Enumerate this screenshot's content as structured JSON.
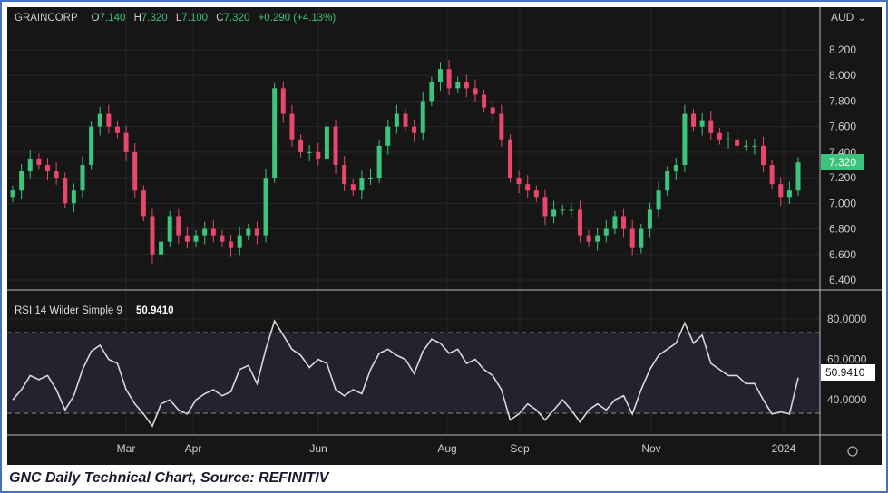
{
  "header": {
    "symbol": "GRAINCORP",
    "o_label": "O",
    "open": "7.140",
    "h_label": "H",
    "high": "7.320",
    "l_label": "L",
    "low": "7.100",
    "c_label": "C",
    "close": "7.320",
    "change": "+0.290 (+4.13%)",
    "currency": "AUD"
  },
  "rsi_header": {
    "label": "RSI 14 Wilder Simple 9",
    "value": "50.9410"
  },
  "caption": "GNC Daily Technical Chart, Source: REFINITIV",
  "colors": {
    "up": "#3cc47c",
    "down": "#e8466a",
    "bg": "#161616",
    "rsi_line": "#d8d8d8",
    "rsi_band": "#25212f",
    "price_tag": "#3cc47c"
  },
  "chart_data": [
    {
      "type": "candlestick",
      "title": "GRAINCORP",
      "ylabel": "AUD",
      "ylim": [
        6.3,
        8.3
      ],
      "yticks": [
        "8.200",
        "8.000",
        "7.800",
        "7.600",
        "7.400",
        "7.200",
        "7.000",
        "6.800",
        "6.600",
        "6.400"
      ],
      "xticks": [
        "Mar",
        "Apr",
        "Jun",
        "Aug",
        "Sep",
        "Nov",
        "2024"
      ],
      "last_price": "7.320",
      "closes": [
        7.1,
        7.25,
        7.35,
        7.3,
        7.25,
        7.2,
        7.0,
        7.1,
        7.3,
        7.6,
        7.7,
        7.6,
        7.55,
        7.4,
        7.1,
        6.9,
        6.6,
        6.7,
        6.9,
        6.75,
        6.7,
        6.75,
        6.8,
        6.75,
        6.7,
        6.65,
        6.75,
        6.8,
        6.75,
        7.2,
        7.9,
        7.7,
        7.5,
        7.4,
        7.4,
        7.35,
        7.6,
        7.3,
        7.15,
        7.1,
        7.2,
        7.2,
        7.45,
        7.6,
        7.7,
        7.6,
        7.55,
        7.8,
        7.95,
        8.05,
        7.9,
        7.95,
        7.9,
        7.85,
        7.75,
        7.7,
        7.5,
        7.2,
        7.15,
        7.1,
        7.05,
        6.9,
        6.95,
        6.95,
        6.95,
        6.75,
        6.7,
        6.75,
        6.8,
        6.9,
        6.8,
        6.65,
        6.8,
        6.95,
        7.1,
        7.25,
        7.3,
        7.7,
        7.6,
        7.65,
        7.55,
        7.5,
        7.5,
        7.45,
        7.45,
        7.45,
        7.3,
        7.15,
        7.05,
        7.1,
        7.32
      ]
    },
    {
      "type": "line",
      "title": "RSI 14 Wilder Simple 9",
      "ylim": [
        20,
        88
      ],
      "yticks": [
        "80.0000",
        "60.0000",
        "40.0000"
      ],
      "bands": [
        30,
        70
      ],
      "last_value": "50.9410",
      "values": [
        40,
        45,
        52,
        50,
        52,
        45,
        35,
        42,
        55,
        64,
        67,
        60,
        58,
        45,
        38,
        33,
        27,
        38,
        40,
        35,
        33,
        40,
        43,
        45,
        42,
        44,
        55,
        57,
        48,
        65,
        79,
        72,
        65,
        62,
        56,
        60,
        58,
        45,
        42,
        45,
        43,
        55,
        63,
        65,
        62,
        60,
        53,
        64,
        70,
        68,
        63,
        65,
        58,
        60,
        55,
        52,
        45,
        30,
        33,
        38,
        35,
        30,
        35,
        40,
        35,
        29,
        35,
        38,
        35,
        40,
        42,
        33,
        45,
        55,
        62,
        65,
        68,
        78,
        68,
        72,
        58,
        55,
        52,
        52,
        48,
        48,
        40,
        33,
        34,
        33,
        50.94
      ]
    }
  ]
}
